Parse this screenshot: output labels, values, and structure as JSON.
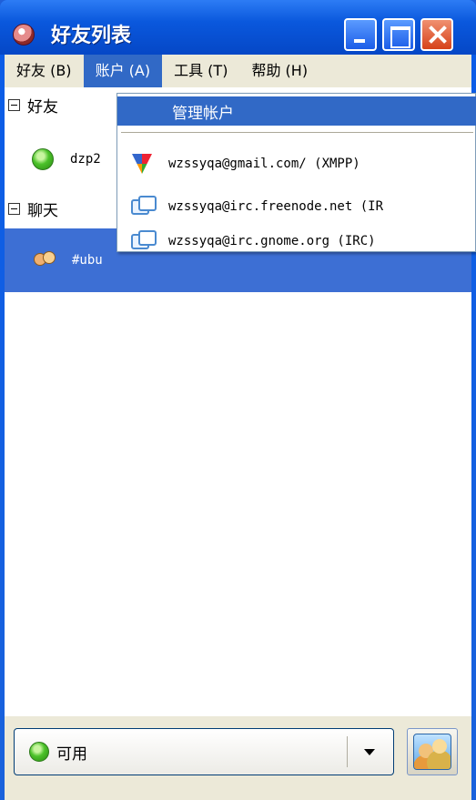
{
  "window": {
    "title": "好友列表"
  },
  "menubar": {
    "items": [
      {
        "label": "好友 (B)"
      },
      {
        "label": "账户 (A)"
      },
      {
        "label": "工具 (T)"
      },
      {
        "label": "帮助 (H)"
      }
    ]
  },
  "tree": {
    "groups": [
      {
        "label": "好友"
      },
      {
        "label": "聊天"
      }
    ],
    "buddy": {
      "name": "dzp2"
    },
    "chat": {
      "name": "#ubu"
    }
  },
  "accounts_menu": {
    "manage_label": "管理帐户",
    "accounts": [
      {
        "label": "wzssyqa@gmail.com/ (XMPP)",
        "icon": "xmpp-icon"
      },
      {
        "label": "wzssyqa@irc.freenode.net (IR",
        "icon": "irc-icon"
      },
      {
        "label": "wzssyqa@irc.gnome.org (IRC)",
        "icon": "irc-icon"
      }
    ]
  },
  "status": {
    "label": "可用"
  },
  "colors": {
    "titlebar": "#0a58dd",
    "selection": "#3169c6",
    "menubar": "#ece9d8"
  }
}
